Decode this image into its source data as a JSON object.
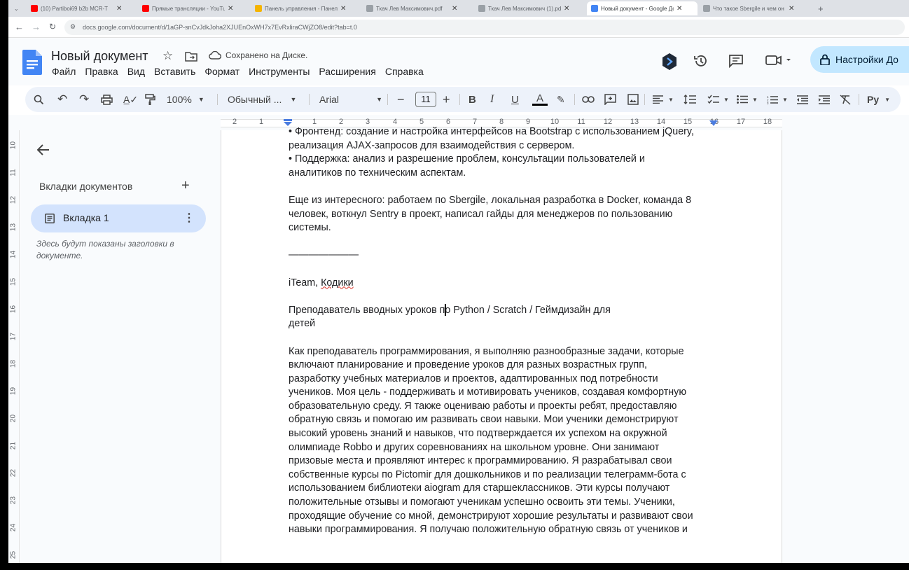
{
  "browser": {
    "tabs": [
      {
        "title": "(10) Partiboi69 b2b MCR-T",
        "active": false,
        "color": "#ff0000"
      },
      {
        "title": "Прямые трансляции - YouTube",
        "active": false,
        "color": "#ff0000"
      },
      {
        "title": "Панель управления - Панель",
        "active": false,
        "color": "#f4b400"
      },
      {
        "title": "Ткач Лев Максимович.pdf",
        "active": false,
        "color": "#9aa0a6"
      },
      {
        "title": "Ткач Лев Максимович (1).pdf",
        "active": false,
        "color": "#9aa0a6"
      },
      {
        "title": "Новый документ - Google До",
        "active": true,
        "color": "#4285f4"
      },
      {
        "title": "Что такое Sbergile и чем он отл",
        "active": false,
        "color": "#9aa0a6"
      }
    ],
    "url": "docs.google.com/document/d/1aGP-snCvJdkJoha2XJUEnOxWH7x7EvRxliraCWjZO8/edit?tab=t.0"
  },
  "header": {
    "doc_title": "Новый документ",
    "saved_status": "Сохранено на Диске.",
    "menu": [
      "Файл",
      "Правка",
      "Вид",
      "Вставить",
      "Формат",
      "Инструменты",
      "Расширения",
      "Справка"
    ],
    "share_label": "Настройки До"
  },
  "toolbar": {
    "zoom": "100%",
    "style": "Обычный ...",
    "font": "Arial",
    "font_size": "11",
    "input_tool": "Ру"
  },
  "ruler": {
    "numbers": [
      "2",
      "1",
      "1",
      "2",
      "3",
      "4",
      "5",
      "6",
      "7",
      "8",
      "9",
      "10",
      "11",
      "12",
      "13",
      "14",
      "15",
      "16",
      "17",
      "18"
    ],
    "vertical": [
      "10",
      "11",
      "12",
      "13",
      "14",
      "15",
      "16",
      "17",
      "18",
      "19",
      "20",
      "21",
      "22",
      "23",
      "24",
      "25"
    ]
  },
  "sidebar": {
    "heading": "Вкладки документов",
    "tab_label": "Вкладка 1",
    "hint": "Здесь будут показаны заголовки в документе."
  },
  "document": {
    "lines": [
      "• Фронтенд: создание и настройка интерфейсов на Bootstrap с использованием jQuery,",
      "реализация AJAX-запросов для взаимодействия с сервером.",
      "• Поддержка: анализ и разрешение проблем, консультации пользователей и",
      "аналитиков по техническим аспектам.",
      "",
      "Еще из интересного: работаем по Sbergile, локальная разработка в Docker, команда 8",
      "человек, воткнул Sentry в проект, написал гайды для менеджеров по пользованию",
      "системы.",
      "",
      "———————",
      "",
      "iTeam, ",
      "",
      "Преподаватель вводных уроков по Python / Scratch / Геймдизайн для",
      "детей",
      "",
      "Как преподаватель программирования, я выполняю разнообразные задачи, которые",
      "включают планирование и проведение уроков для разных возрастных групп,",
      "разработку учебных материалов и проектов, адаптированных под потребности",
      "учеников. Моя цель - поддерживать и мотивировать учеников, создавая комфортную",
      "образовательную среду. Я также оцениваю работы и проекты ребят, предоставляю",
      "обратную связь и помогаю им развивать свои навыки. Мои ученики демонстрируют",
      "высокий уровень знаний и навыков, что подтверждается их успехом на окружной",
      "олимпиаде Robbo и других соревнованиях на школьном уровне. Они занимают",
      "призовые места и проявляют интерес к программированию. Я разрабатывал свои",
      "собственные курсы по Pictomir для дошкольников и по реализации телеграмм-бота с",
      "использованием библиотеки aiogram для старшеклассников. Эти курсы получают",
      "положительные отзывы и помогают ученикам успешно освоить эти темы. Ученики,",
      "проходящие обучение со мной, демонстрируют хорошие результаты и развивают свои",
      "навыки программирования. Я получаю положительную обратную связь от учеников и"
    ],
    "misspelled_word": "Кодики"
  }
}
